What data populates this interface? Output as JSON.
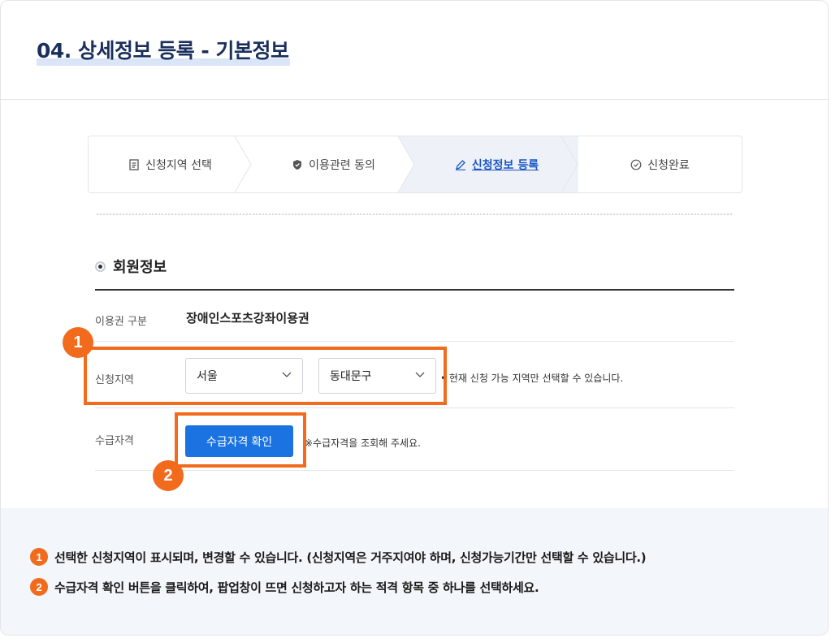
{
  "page": {
    "title": "04. 상세정보 등록 - 기본정보"
  },
  "stepper": {
    "steps": [
      {
        "label": "신청지역 선택",
        "icon": "document-icon"
      },
      {
        "label": "이용관련 동의",
        "icon": "shield-icon"
      },
      {
        "label": "신청정보 등록",
        "icon": "pencil-icon"
      },
      {
        "label": "신청완료",
        "icon": "check-circle-icon"
      }
    ],
    "active_index": 2
  },
  "section": {
    "title": "회원정보"
  },
  "form": {
    "voucher_label": "이용권 구분",
    "voucher_value": "장애인스포츠강좌이용권",
    "region_label": "신청지역",
    "city_value": "서울",
    "district_value": "동대문구",
    "region_hint": "• 현재 신청 가능 지역만 선택할 수 있습니다.",
    "eligibility_label": "수급자격",
    "eligibility_button": "수급자격 확인",
    "eligibility_hint": "※수급자격을 조회해 주세요."
  },
  "callouts": {
    "one": "1",
    "two": "2"
  },
  "notes": [
    {
      "num": "1",
      "text": "선택한 신청지역이 표시되며, 변경할 수 있습니다. (신청지역은 거주지여야 하며, 신청가능기간만 선택할 수 있습니다.)"
    },
    {
      "num": "2",
      "text": "수급자격 확인 버튼을 클릭하여, 팝업창이 뜨면 신청하고자 하는 적격 항목 중 하나를 선택하세요."
    }
  ],
  "colors": {
    "accent": "#f26b1d",
    "primary": "#1a73e0",
    "title": "#1a2f5c"
  }
}
